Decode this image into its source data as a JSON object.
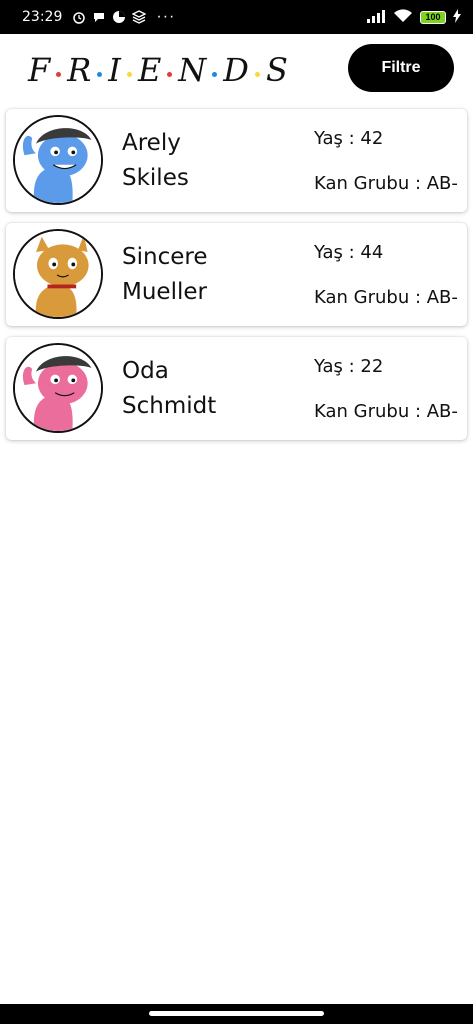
{
  "status_bar": {
    "time": "23:29",
    "dots": "···",
    "battery": "100"
  },
  "header": {
    "logo_letters": [
      "F",
      "R",
      "I",
      "E",
      "N",
      "D",
      "S"
    ],
    "logo_dot_colors": [
      "#e53935",
      "#1e88e5",
      "#fdd835",
      "#e53935",
      "#1e88e5",
      "#fdd835"
    ],
    "filter_label": "Filtre"
  },
  "friends": [
    {
      "first_name": "Arely",
      "last_name": "Skiles",
      "age": "Yaş : 42",
      "blood_type": "Kan Grubu : AB-",
      "avatar_icon": "blue-cat-bandana-icon",
      "avatar_color": "#5b9bea"
    },
    {
      "first_name": "Sincere",
      "last_name": "Mueller",
      "age": "Yaş : 44",
      "blood_type": "Kan Grubu : AB-",
      "avatar_icon": "orange-cat-icon",
      "avatar_color": "#d99a3c"
    },
    {
      "first_name": "Oda",
      "last_name": "Schmidt",
      "age": "Yaş : 22",
      "blood_type": "Kan Grubu : AB-",
      "avatar_icon": "pink-cat-bandana-icon",
      "avatar_color": "#ea6d9b"
    }
  ]
}
